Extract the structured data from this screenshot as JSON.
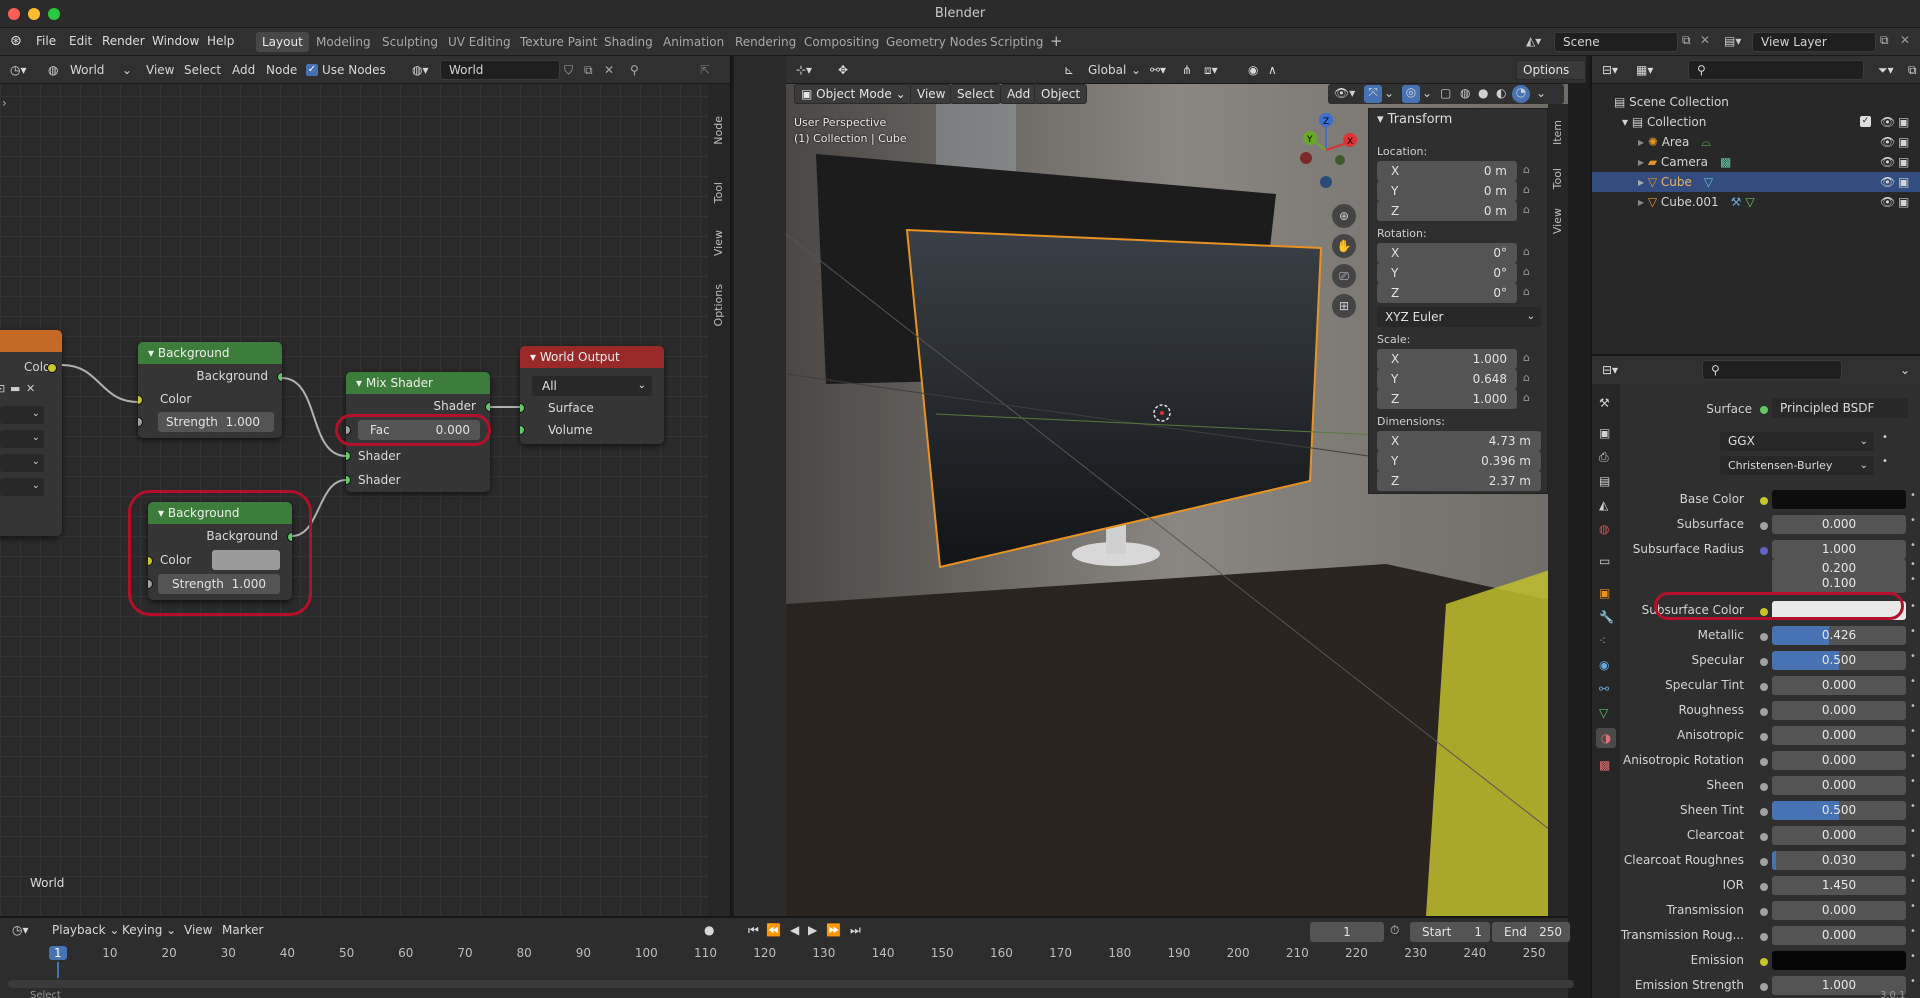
{
  "window": {
    "title": "Blender"
  },
  "menus": [
    "File",
    "Edit",
    "Render",
    "Window",
    "Help"
  ],
  "workspaces": [
    "Layout",
    "Modeling",
    "Sculpting",
    "UV Editing",
    "Texture Paint",
    "Shading",
    "Animation",
    "Rendering",
    "Compositing",
    "Geometry Nodes",
    "Scripting"
  ],
  "active_workspace": "Layout",
  "scene": {
    "scene_name": "Scene",
    "view_layer": "View Layer"
  },
  "node_editor": {
    "type_label": "World",
    "menus": [
      "View",
      "Select",
      "Add",
      "Node"
    ],
    "use_nodes_label": "Use Nodes",
    "use_nodes_checked": true,
    "world_name": "World",
    "footer_label": "World",
    "sidebar_tabs": [
      "Node",
      "Tool",
      "View",
      "Options"
    ],
    "partial_node_output": "Color",
    "nodes": {
      "background1": {
        "title": "Background",
        "output": "Background",
        "color_label": "Color",
        "strength_label": "Strength",
        "strength_value": "1.000"
      },
      "background2": {
        "title": "Background",
        "output": "Background",
        "color_label": "Color",
        "strength_label": "Strength",
        "strength_value": "1.000"
      },
      "mix_shader": {
        "title": "Mix Shader",
        "output": "Shader",
        "fac_label": "Fac",
        "fac_value": "0.000",
        "input1": "Shader",
        "input2": "Shader"
      },
      "world_output": {
        "title": "World Output",
        "target": "All",
        "surface": "Surface",
        "volume": "Volume"
      }
    }
  },
  "viewport": {
    "transform_orientation": "Global",
    "options_label": "Options",
    "mode": "Object Mode",
    "menus": [
      "View",
      "Select",
      "Add",
      "Object"
    ],
    "overlay_line1": "User Perspective",
    "overlay_line2": "(1) Collection | Cube",
    "gizmo_axes": [
      "Z",
      "Y",
      "X"
    ],
    "sidebar_tabs": [
      "Item",
      "Tool",
      "View"
    ],
    "transform": {
      "title": "Transform",
      "location_label": "Location:",
      "location": {
        "X": "0 m",
        "Y": "0 m",
        "Z": "0 m"
      },
      "rotation_label": "Rotation:",
      "rotation": {
        "X": "0°",
        "Y": "0°",
        "Z": "0°"
      },
      "rotation_mode": "XYZ Euler",
      "scale_label": "Scale:",
      "scale": {
        "X": "1.000",
        "Y": "0.648",
        "Z": "1.000"
      },
      "dimensions_label": "Dimensions:",
      "dimensions": {
        "X": "4.73 m",
        "Y": "0.396 m",
        "Z": "2.37 m"
      }
    }
  },
  "outliner": {
    "scene_collection": "Scene Collection",
    "collection": "Collection",
    "items": [
      {
        "name": "Area",
        "selected": false
      },
      {
        "name": "Camera",
        "selected": false
      },
      {
        "name": "Cube",
        "selected": true
      },
      {
        "name": "Cube.001",
        "selected": false
      }
    ]
  },
  "properties": {
    "surface_label": "Surface",
    "surface_value": "Principled BSDF",
    "distribution": "GGX",
    "subsurface_method": "Christensen-Burley",
    "rows": [
      {
        "label": "Base Color",
        "type": "color",
        "color": "#0d0d0d",
        "socket": "#c7c729"
      },
      {
        "label": "Subsurface",
        "value": "0.000",
        "fill": 0
      },
      {
        "label": "Subsurface Radius",
        "value": "1.000",
        "fill": 0,
        "socket": "#6363c7"
      },
      {
        "label": "",
        "value": "0.200",
        "fill": 0,
        "nosock": true
      },
      {
        "label": "",
        "value": "0.100",
        "fill": 0,
        "nosock": true
      },
      {
        "label": "Subsurface Color",
        "type": "color",
        "color": "#e8e8e8",
        "socket": "#c7c729"
      },
      {
        "label": "Metallic",
        "value": "0.426",
        "fill": 0.426
      },
      {
        "label": "Specular",
        "value": "0.500",
        "fill": 0.5
      },
      {
        "label": "Specular Tint",
        "value": "0.000",
        "fill": 0
      },
      {
        "label": "Roughness",
        "value": "0.000",
        "fill": 0
      },
      {
        "label": "Anisotropic",
        "value": "0.000",
        "fill": 0
      },
      {
        "label": "Anisotropic Rotation",
        "value": "0.000",
        "fill": 0
      },
      {
        "label": "Sheen",
        "value": "0.000",
        "fill": 0
      },
      {
        "label": "Sheen Tint",
        "value": "0.500",
        "fill": 0.5
      },
      {
        "label": "Clearcoat",
        "value": "0.000",
        "fill": 0
      },
      {
        "label": "Clearcoat Roughnes",
        "value": "0.030",
        "fill": 0.03
      },
      {
        "label": "IOR",
        "value": "1.450",
        "fill": 0
      },
      {
        "label": "Transmission",
        "value": "0.000",
        "fill": 0
      },
      {
        "label": "Transmission Roug...",
        "value": "0.000",
        "fill": 0
      },
      {
        "label": "Emission",
        "type": "color",
        "color": "#050505",
        "socket": "#c7c729"
      },
      {
        "label": "Emission Strength",
        "value": "1.000",
        "fill": 0
      }
    ]
  },
  "timeline": {
    "menus": [
      "Playback",
      "Keying",
      "View",
      "Marker"
    ],
    "current_frame": "1",
    "start_label": "Start",
    "start": "1",
    "end_label": "End",
    "end": "250",
    "ticks": [
      "1",
      "10",
      "20",
      "30",
      "40",
      "50",
      "60",
      "70",
      "80",
      "90",
      "100",
      "110",
      "120",
      "130",
      "140",
      "150",
      "160",
      "170",
      "180",
      "190",
      "200",
      "210",
      "220",
      "230",
      "240",
      "250"
    ],
    "status_select": "Select",
    "version": "3.0.1"
  },
  "colors": {
    "accent": "#4772b3",
    "node_green": "#3c7d3c",
    "node_red": "#9a2a2a",
    "highlight_ring": "#b5102a",
    "selection_orange": "#e69324"
  }
}
